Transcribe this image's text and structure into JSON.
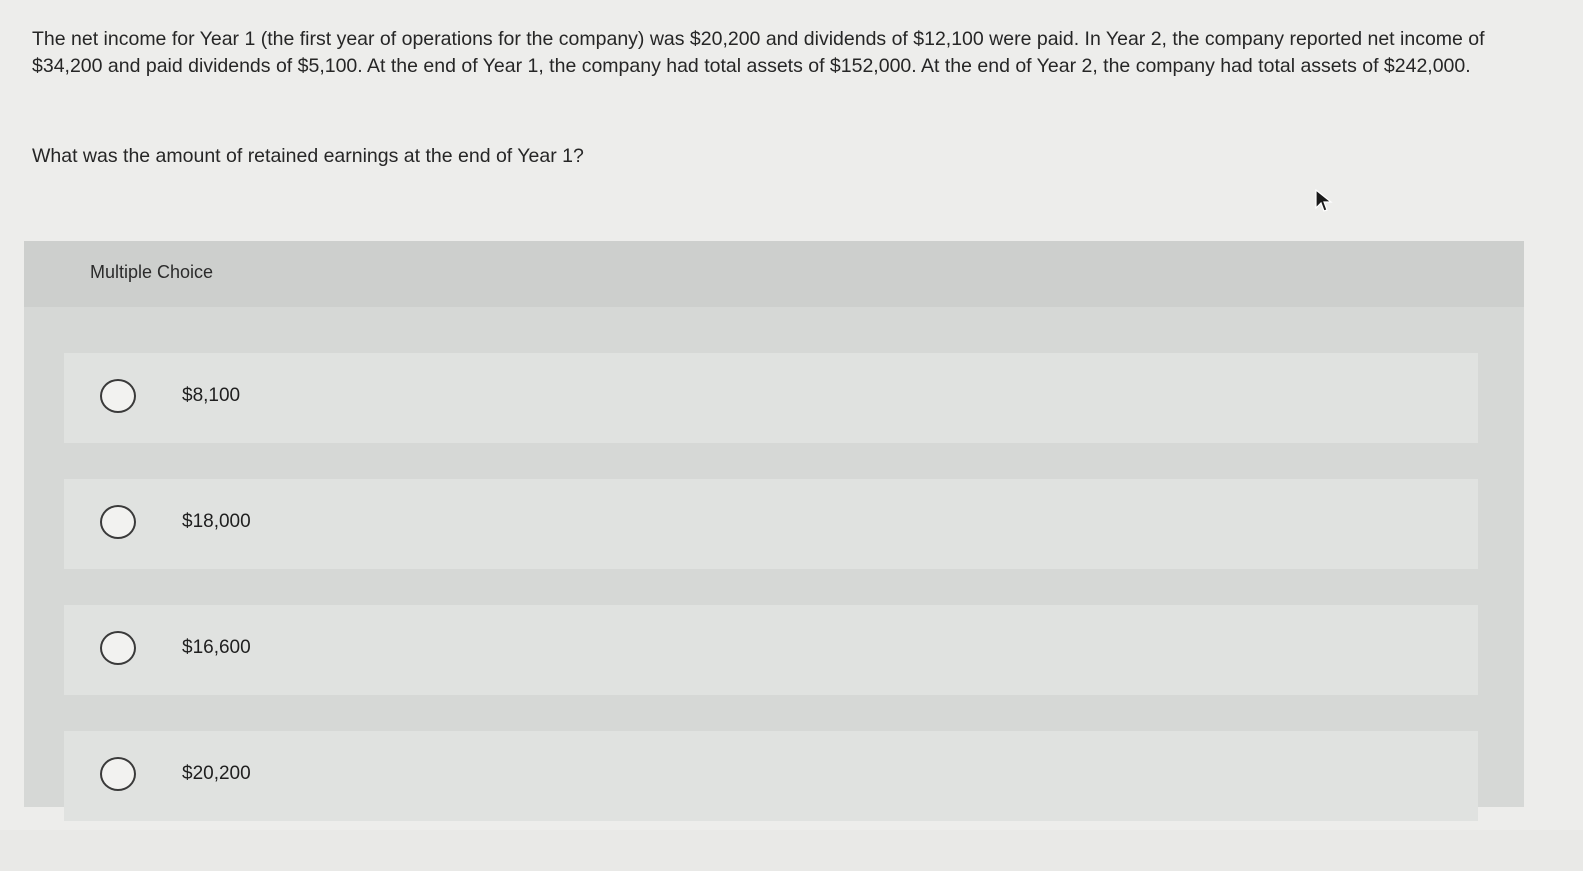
{
  "question": {
    "text": "The net income for Year 1 (the first year of operations for the company) was $20,200 and dividends of $12,100 were paid. In Year 2, the company reported net income of $34,200 and paid dividends of $5,100. At the end of Year 1, the company had total assets of $152,000. At the end of Year 2, the company had total assets of $242,000.",
    "prompt": "What was the amount of retained earnings at the end of Year 1?"
  },
  "multiple_choice": {
    "header": "Multiple Choice",
    "options": [
      {
        "label": "$8,100"
      },
      {
        "label": "$18,000"
      },
      {
        "label": "$16,600"
      },
      {
        "label": "$20,200"
      }
    ]
  }
}
